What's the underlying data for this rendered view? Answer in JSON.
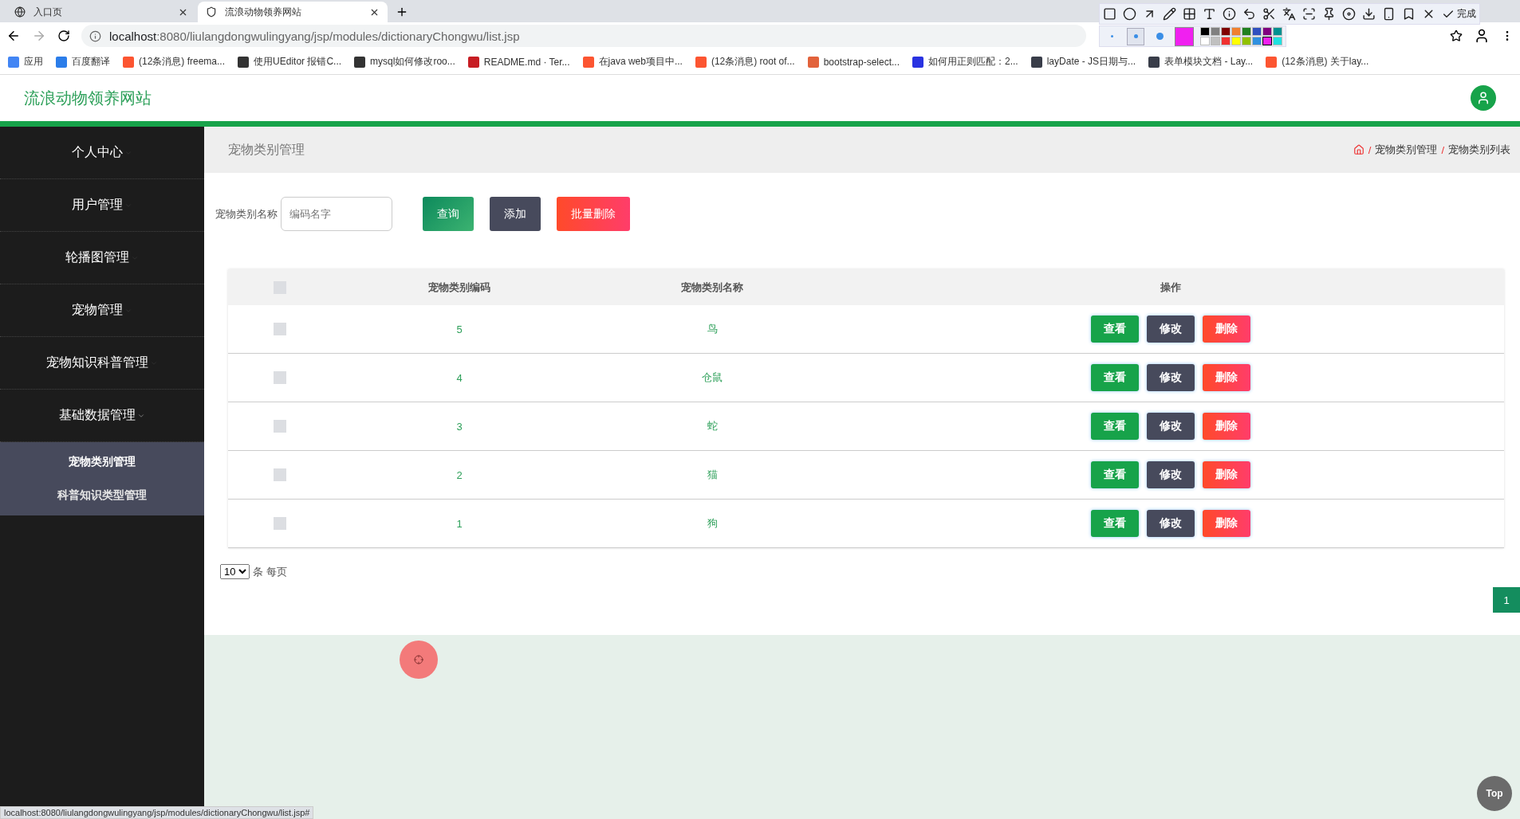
{
  "browser": {
    "tabs": [
      {
        "title": "入口页",
        "selected": false,
        "kind": "globe"
      },
      {
        "title": "流浪动物领养网站",
        "selected": true,
        "kind": "shield"
      }
    ],
    "url_host": "localhost",
    "url_rest": ":8080/liulangdongwulingyang/jsp/modules/dictionaryChongwu/list.jsp",
    "bookmarks": [
      {
        "label": "应用",
        "color": "#4285f4"
      },
      {
        "label": "百度翻译",
        "color": "#2b7de9"
      },
      {
        "label": "(12条消息) freema...",
        "color": "#fc5531"
      },
      {
        "label": "使用UEditor 报错C...",
        "color": "#333333"
      },
      {
        "label": "mysql如何修改roo...",
        "color": "#333333"
      },
      {
        "label": "README.md · Ter...",
        "color": "#c71d23"
      },
      {
        "label": "在java web项目中...",
        "color": "#fc5531"
      },
      {
        "label": "(12条消息) root of...",
        "color": "#fc5531"
      },
      {
        "label": "bootstrap-select...",
        "color": "#e2623b"
      },
      {
        "label": "如何用正则匹配：2...",
        "color": "#2932e1"
      },
      {
        "label": "layDate - JS日期与...",
        "color": "#393d49"
      },
      {
        "label": "表单模块文档 - Lay...",
        "color": "#393d49"
      },
      {
        "label": "(12条消息) 关于lay...",
        "color": "#fc5531"
      }
    ],
    "annotation_toolbar": {
      "done_label": "完成",
      "sizes": [
        {
          "selected": false
        },
        {
          "selected": true
        },
        {
          "selected": false
        }
      ],
      "colors": [
        {
          "color": "#000000",
          "selected": false
        },
        {
          "color": "#808080",
          "selected": false
        },
        {
          "color": "#800000",
          "selected": false
        },
        {
          "color": "#f08030",
          "selected": false
        },
        {
          "color": "#208020",
          "selected": false
        },
        {
          "color": "#3050c0",
          "selected": false
        },
        {
          "color": "#800080",
          "selected": false
        },
        {
          "color": "#009090",
          "selected": false
        },
        {
          "color": "#ffffff",
          "selected": false
        },
        {
          "color": "#c0c0c0",
          "selected": false
        },
        {
          "color": "#f03030",
          "selected": false
        },
        {
          "color": "#ffff00",
          "selected": false
        },
        {
          "color": "#90c000",
          "selected": false
        },
        {
          "color": "#3090e0",
          "selected": false
        },
        {
          "color": "#f020f0",
          "selected": true
        },
        {
          "color": "#20e0e0",
          "selected": false
        }
      ]
    },
    "status_url": "localhost:8080/liulangdongwulingyang/jsp/modules/dictionaryChongwu/list.jsp#"
  },
  "site_title": "流浪动物领养网站",
  "sidebar": {
    "items": [
      {
        "label": "个人中心",
        "expanded": false
      },
      {
        "label": "用户管理",
        "expanded": false
      },
      {
        "label": "轮播图管理",
        "expanded": false
      },
      {
        "label": "宠物管理",
        "expanded": false
      },
      {
        "label": "宠物知识科普管理",
        "expanded": false
      },
      {
        "label": "基础数据管理",
        "expanded": true,
        "children": [
          {
            "label": "宠物类别管理",
            "selected": true
          },
          {
            "label": "科普知识类型管理",
            "selected": false
          }
        ]
      }
    ]
  },
  "page_header": {
    "title": "宠物类别管理",
    "breadcrumb": [
      {
        "separator": "/",
        "label": "宠物类别管理"
      },
      {
        "separator": "/",
        "label": "宠物类别列表"
      }
    ]
  },
  "search": {
    "label": "宠物类别名称",
    "placeholder": "编码名字",
    "buttons": [
      {
        "label": "查询",
        "kind": "search"
      },
      {
        "label": "添加",
        "kind": "add"
      },
      {
        "label": "批量删除",
        "kind": "delete"
      }
    ]
  },
  "table": {
    "columns": [
      "宠物类别编码",
      "宠物类别名称",
      "操作"
    ],
    "header_checked": false,
    "rows": [
      {
        "checked": false,
        "code": "5",
        "name": "鸟",
        "actions": [
          {
            "label": "查看",
            "kind": "view"
          },
          {
            "label": "修改",
            "kind": "edit"
          },
          {
            "label": "删除",
            "kind": "delete"
          }
        ]
      },
      {
        "checked": false,
        "code": "4",
        "name": "仓鼠",
        "actions": [
          {
            "label": "查看",
            "kind": "view"
          },
          {
            "label": "修改",
            "kind": "edit"
          },
          {
            "label": "删除",
            "kind": "delete"
          }
        ]
      },
      {
        "checked": false,
        "code": "3",
        "name": "蛇",
        "actions": [
          {
            "label": "查看",
            "kind": "view"
          },
          {
            "label": "修改",
            "kind": "edit"
          },
          {
            "label": "删除",
            "kind": "delete"
          }
        ]
      },
      {
        "checked": false,
        "code": "2",
        "name": "猫",
        "actions": [
          {
            "label": "查看",
            "kind": "view"
          },
          {
            "label": "修改",
            "kind": "edit"
          },
          {
            "label": "删除",
            "kind": "delete"
          }
        ]
      },
      {
        "checked": false,
        "code": "1",
        "name": "狗",
        "actions": [
          {
            "label": "查看",
            "kind": "view"
          },
          {
            "label": "修改",
            "kind": "edit"
          },
          {
            "label": "删除",
            "kind": "delete"
          }
        ]
      }
    ]
  },
  "pagination": {
    "page_size": "10",
    "page_size_suffix": "条 每页",
    "pages": [
      {
        "label": "1",
        "selected": true
      }
    ]
  },
  "top_button": "Top"
}
